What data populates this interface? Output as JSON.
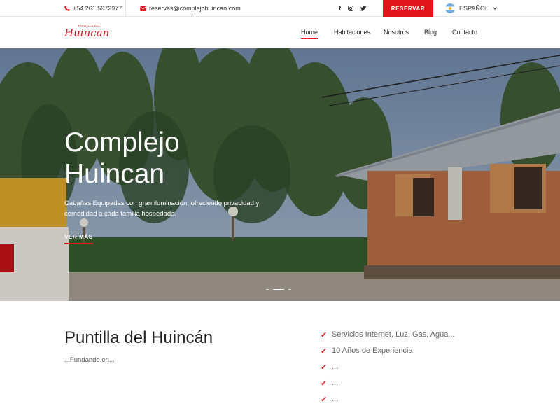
{
  "topbar": {
    "phone": "+54 261 5972977",
    "email": "reservas@complejohuincan.com",
    "social_icons": [
      "facebook-icon",
      "instagram-icon",
      "twitter-icon"
    ],
    "reserve_label": "RESERVAR",
    "language": "ESPAÑOL",
    "accent_color": "#e0161b"
  },
  "logo": {
    "small": "PUNTILLA DEL",
    "big": "Huincan"
  },
  "nav": {
    "items": [
      "Home",
      "Habitaciones",
      "Nosotros",
      "Blog",
      "Contacto"
    ],
    "active": "Home"
  },
  "hero": {
    "title_line1": "Complejo",
    "title_line2": "Huincan",
    "subtitle": "Cabañas Equipadas con gran iluminación, ofreciendo privacidad y comodidad a cada familia hospedada.",
    "cta": "VER MÁS",
    "slides": 3,
    "active_slide": 2
  },
  "about": {
    "title": "Puntilla del Huincán",
    "subtitle": "...Fundando en...",
    "features": [
      "Servicios Internet, Luz, Gas, Agua...",
      "10 Años de Experiencia",
      "...",
      "...",
      "..."
    ]
  }
}
